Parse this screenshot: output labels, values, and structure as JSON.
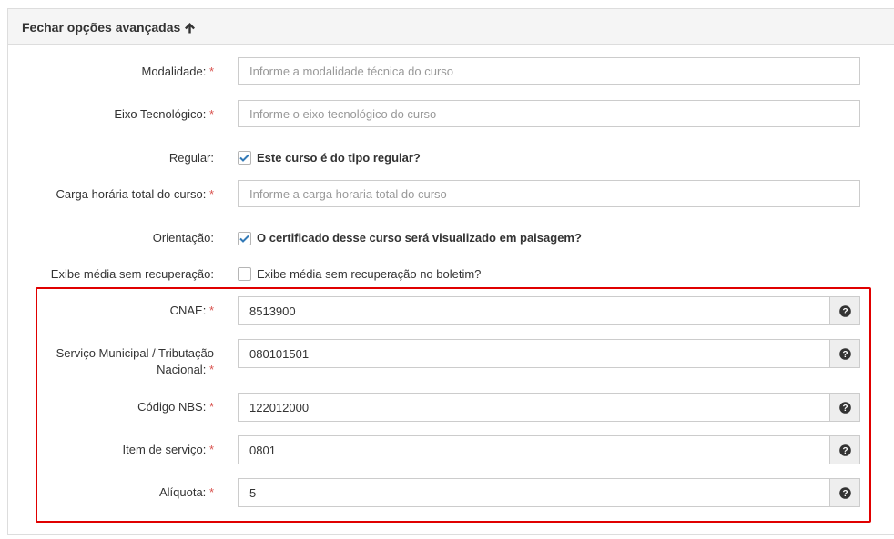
{
  "panel": {
    "title": "Fechar opções avançadas"
  },
  "fields": {
    "modalidade": {
      "label": "Modalidade:",
      "required": "*",
      "placeholder": "Informe a modalidade técnica do curso",
      "value": ""
    },
    "eixo": {
      "label": "Eixo Tecnológico:",
      "required": "*",
      "placeholder": "Informe o eixo tecnológico do curso",
      "value": ""
    },
    "regular": {
      "label": "Regular:",
      "checkbox_text": "Este curso é do tipo regular?",
      "checked": true
    },
    "carga": {
      "label": "Carga horária total do curso:",
      "required": "*",
      "placeholder": "Informe a carga horaria total do curso",
      "value": ""
    },
    "orientacao": {
      "label": "Orientação:",
      "checkbox_text": "O certificado desse curso será visualizado em paisagem?",
      "checked": true
    },
    "exibe_media": {
      "label": "Exibe média sem recuperação:",
      "checkbox_text": "Exibe média sem recuperação no boletim?",
      "checked": false
    },
    "cnae": {
      "label": "CNAE:",
      "required": "*",
      "value": "8513900"
    },
    "servico_municipal": {
      "label_line1": "Serviço Municipal / Tributação",
      "label_line2": "Nacional:",
      "required": "*",
      "value": "080101501"
    },
    "codigo_nbs": {
      "label": "Código NBS:",
      "required": "*",
      "value": "122012000"
    },
    "item_servico": {
      "label": "Item de serviço:",
      "required": "*",
      "value": "0801"
    },
    "aliquota": {
      "label": "Alíquota:",
      "required": "*",
      "value": "5"
    }
  },
  "icons": {
    "collapse": "arrow-up-icon",
    "help": "question-circle-icon"
  },
  "colors": {
    "highlight_border": "#e00000",
    "required_asterisk": "#d9534f",
    "checkbox_check": "#337ab7",
    "panel_header_bg": "#f5f5f5"
  }
}
